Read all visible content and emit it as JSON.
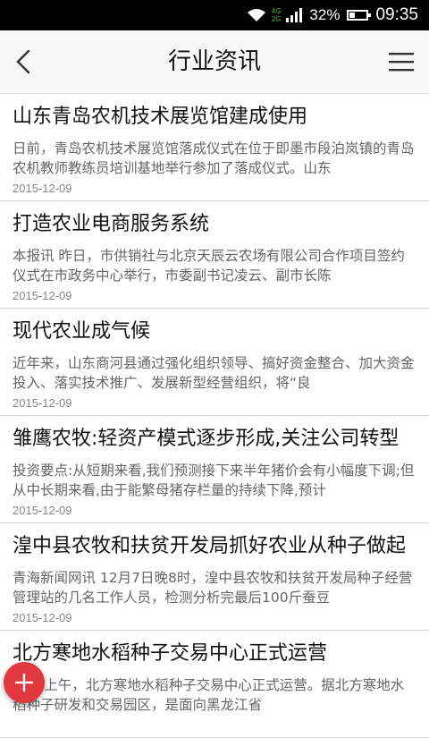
{
  "status_bar": {
    "network_top": "4G",
    "network_bottom": "2G",
    "battery": "32%",
    "battery_level": 0.32,
    "time": "09:35"
  },
  "header": {
    "title": "行业资讯",
    "back_icon": "chevron-left-icon",
    "menu_icon": "hamburger-menu-icon"
  },
  "articles": [
    {
      "title": "山东青岛农机技术展览馆建成使用",
      "summary": "日前，青岛农机技术展览馆落成仪式在位于即墨市段泊岚镇的青岛农机教师教练员培训基地举行参加了落成仪式。山东",
      "date": "2015-12-09"
    },
    {
      "title": "打造农业电商服务系统",
      "summary": "本报讯 昨日，市供销社与北京天辰云农场有限公司合作项目签约仪式在市政务中心举行，市委副书记凌云、副市长陈",
      "date": "2015-12-09"
    },
    {
      "title": "现代农业成气候",
      "summary": "近年来，山东商河县通过强化组织领导、搞好资金整合、加大资金投入、落实技术推广、发展新型经营组织，将“良",
      "date": "2015-12-09"
    },
    {
      "title": "雏鹰农牧:轻资产模式逐步形成,关注公司转型",
      "summary": "投资要点:从短期来看,我们预测接下来半年猪价会有小幅度下调;但从中长期来看,由于能繁母猪存栏量的持续下降,预计",
      "date": "2015-12-09"
    },
    {
      "title": "湟中县农牧和扶贫开发局抓好农业从种子做起",
      "summary": "青海新闻网讯 12月7日晚8时，湟中县农牧和扶贫开发局种子经营管理站的几名工作人员，检测分析完最后100斤蚕豆",
      "date": "2015-12-09"
    },
    {
      "title": "北方寒地水稻种子交易中心正式运营",
      "summary": "27日上午，北方寒地水稻种子交易中心正式运营。据北方寒地水稻种子研发和交易园区，是面向黑龙江省",
      "date": ""
    }
  ],
  "fab": {
    "icon": "plus-icon",
    "color": "#e0383e"
  }
}
